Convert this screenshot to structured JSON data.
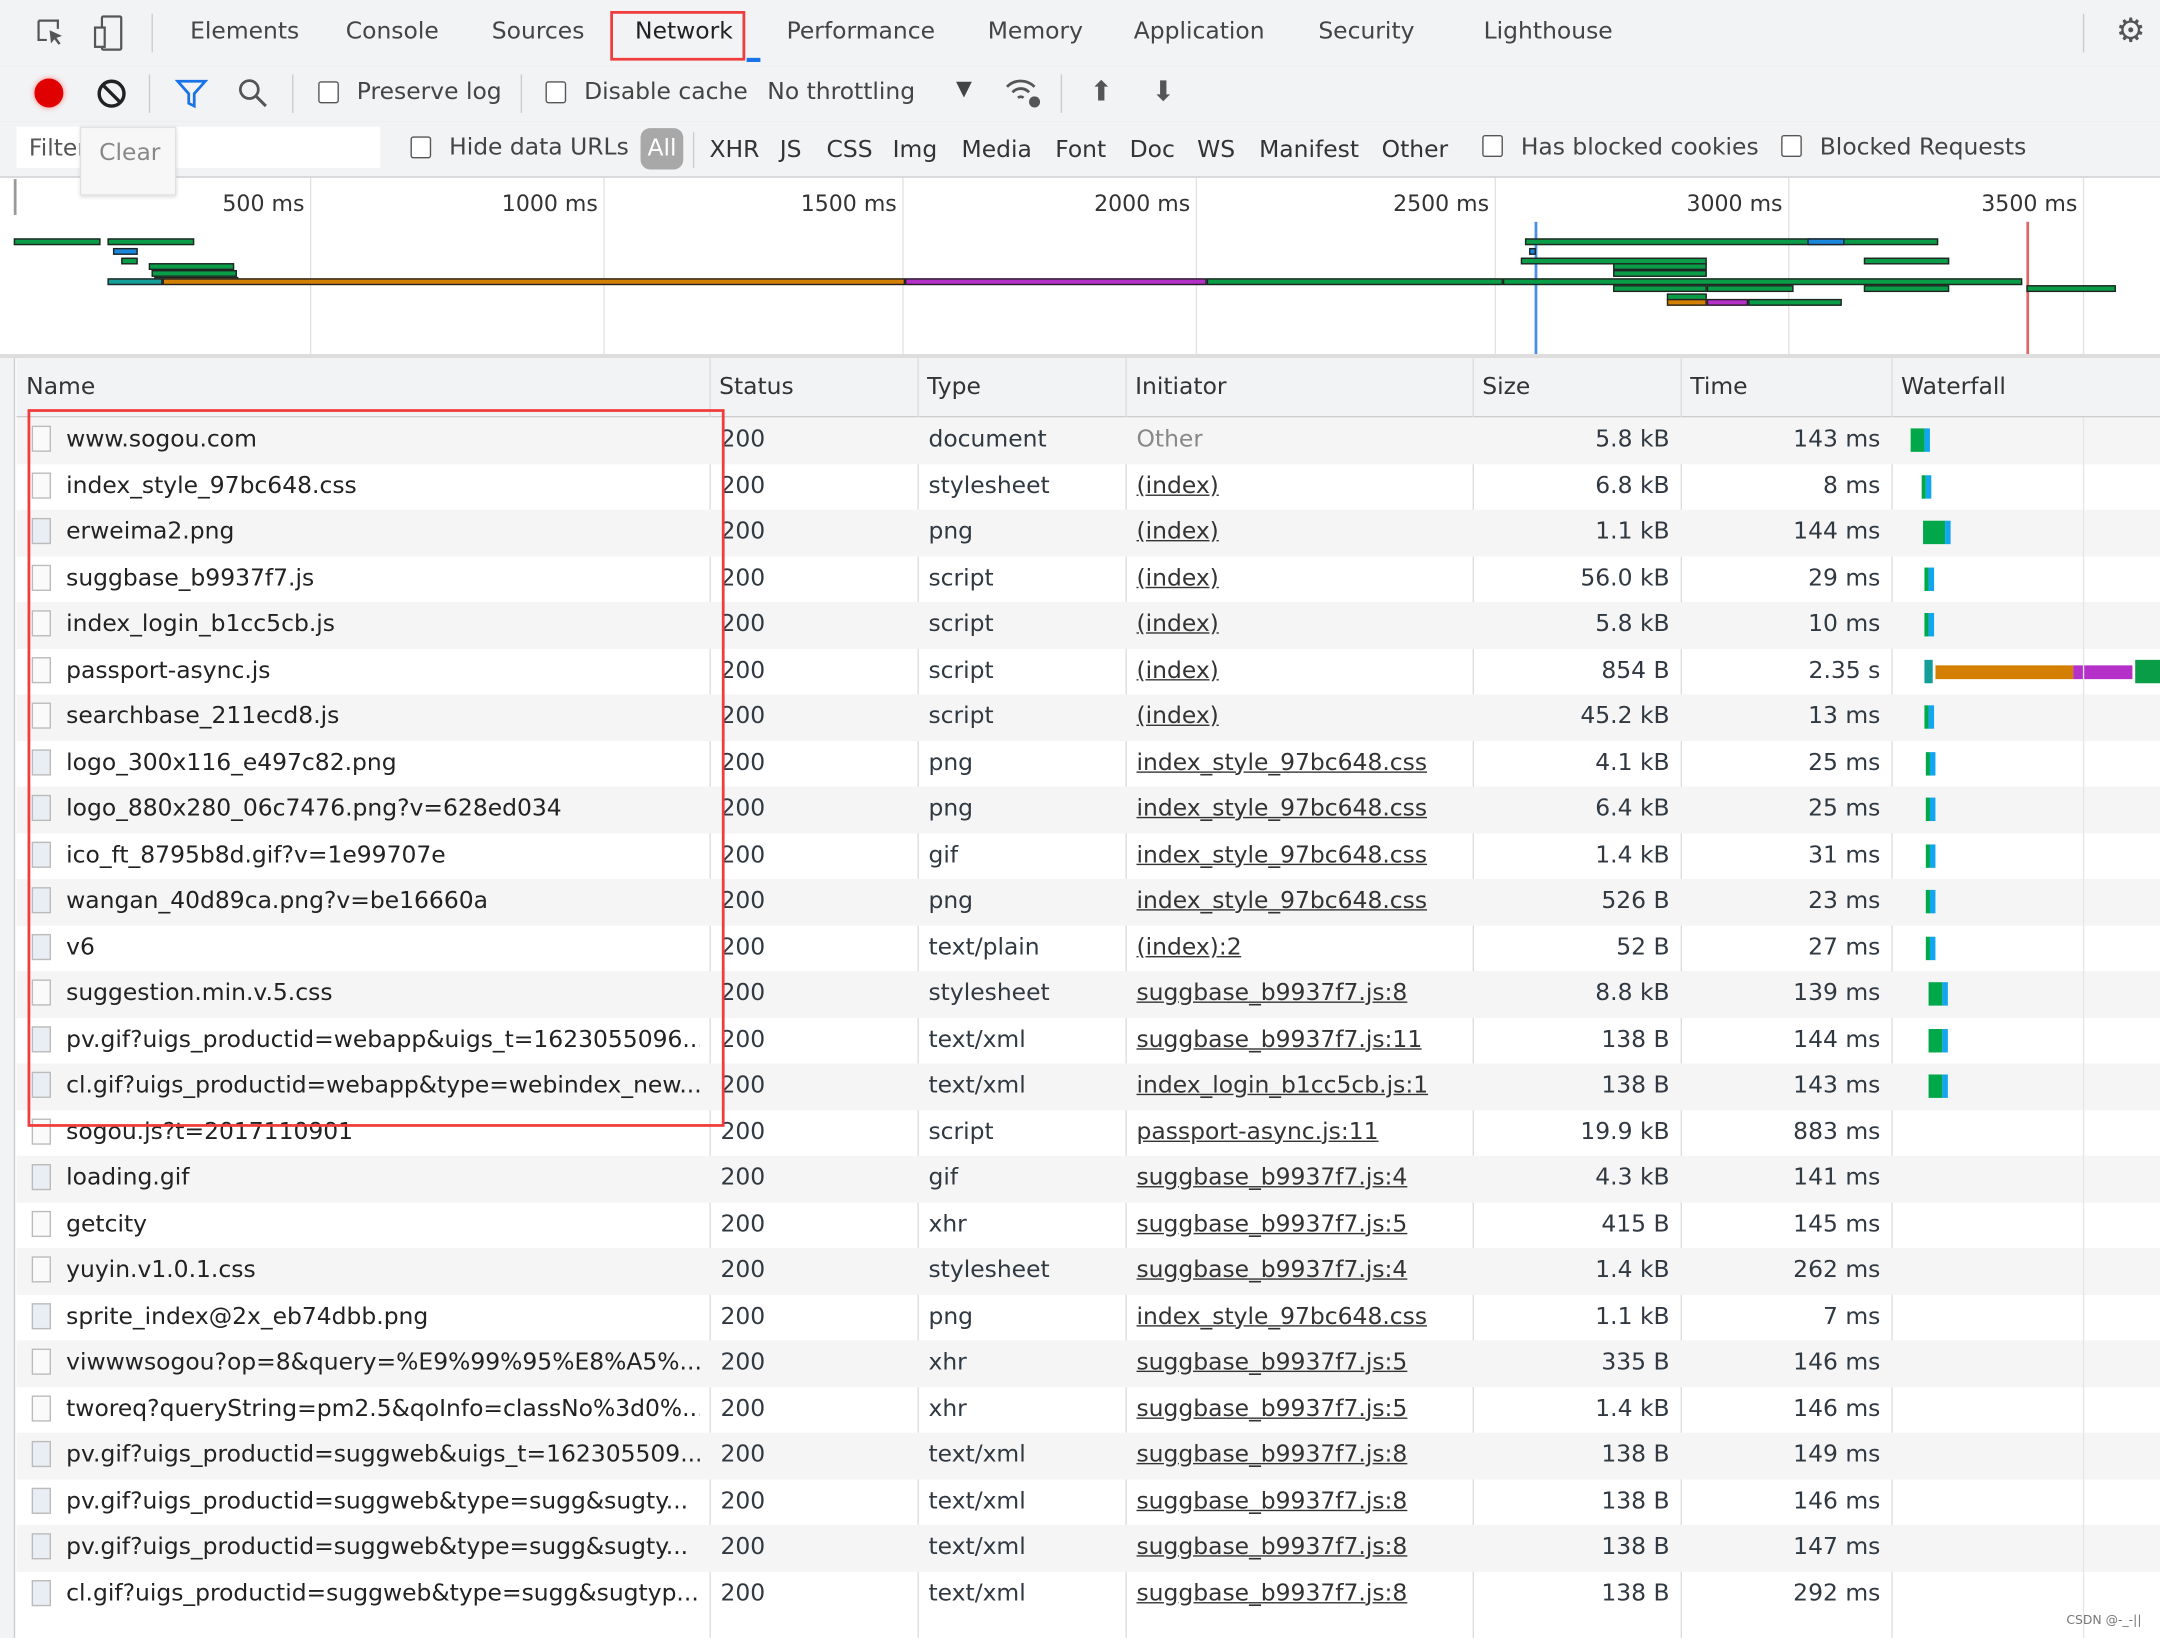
{
  "tabs": [
    "Elements",
    "Console",
    "Sources",
    "Network",
    "Performance",
    "Memory",
    "Application",
    "Security",
    "Lighthouse"
  ],
  "active_tab": "Network",
  "toolbar": {
    "preserve_log": "Preserve log",
    "disable_cache": "Disable cache",
    "throttling": "No throttling"
  },
  "filter": {
    "placeholder": "Filter",
    "clear_tooltip": "Clear",
    "hide_data_urls": "Hide data URLs",
    "types": [
      "All",
      "XHR",
      "JS",
      "CSS",
      "Img",
      "Media",
      "Font",
      "Doc",
      "WS",
      "Manifest",
      "Other"
    ],
    "has_blocked_cookies": "Has blocked cookies",
    "blocked_requests": "Blocked Requests"
  },
  "overview": {
    "ticks": [
      "500 ms",
      "1000 ms",
      "1500 ms",
      "2000 ms",
      "2500 ms",
      "3000 ms",
      "3500 ms"
    ],
    "dom_content_loaded_ms": 2570,
    "load_ms": 3400,
    "colors": {
      "green": "#0a9d48",
      "orange": "#d57f00",
      "purple": "#b52fc9",
      "teal": "#139e9a",
      "blue": "#1a87de"
    },
    "bars": [
      {
        "lane": 0,
        "s": 0,
        "e": 147,
        "c": "green"
      },
      {
        "lane": 0,
        "s": 158,
        "e": 305,
        "c": "green"
      },
      {
        "lane": 1,
        "s": 168,
        "e": 210,
        "c": "blue"
      },
      {
        "lane": 2,
        "s": 181,
        "e": 210,
        "c": "green"
      },
      {
        "lane": 3,
        "s": 228,
        "e": 372,
        "c": "green"
      },
      {
        "lane": 4,
        "s": 233,
        "e": 377,
        "c": "green"
      },
      {
        "lane": 5,
        "s": 237,
        "e": 379,
        "c": "green"
      },
      {
        "lane": 6,
        "s": 158,
        "e": 251,
        "c": "teal"
      },
      {
        "lane": 6,
        "s": 251,
        "e": 1505,
        "c": "orange"
      },
      {
        "lane": 6,
        "s": 1505,
        "e": 2016,
        "c": "purple"
      },
      {
        "lane": 6,
        "s": 2016,
        "e": 2516,
        "c": "green"
      },
      {
        "lane": 6,
        "s": 2516,
        "e": 3395,
        "c": "green"
      },
      {
        "lane": 0,
        "s": 2553,
        "e": 3253,
        "c": "green"
      },
      {
        "lane": 0,
        "s": 3030,
        "e": 3093,
        "c": "blue"
      },
      {
        "lane": 1,
        "s": 2560,
        "e": 2572,
        "c": "blue"
      },
      {
        "lane": 2,
        "s": 2547,
        "e": 2860,
        "c": "green"
      },
      {
        "lane": 2,
        "s": 3125,
        "e": 3270,
        "c": "green"
      },
      {
        "lane": 3,
        "s": 2702,
        "e": 2860,
        "c": "green"
      },
      {
        "lane": 4,
        "s": 2702,
        "e": 2860,
        "c": "green"
      },
      {
        "lane": 7,
        "s": 2702,
        "e": 2860,
        "c": "green"
      },
      {
        "lane": 7,
        "s": 2860,
        "e": 3007,
        "c": "green"
      },
      {
        "lane": 7,
        "s": 3125,
        "e": 3270,
        "c": "green"
      },
      {
        "lane": 7,
        "s": 3400,
        "e": 3553,
        "c": "green"
      },
      {
        "lane": 8,
        "s": 2793,
        "e": 2860,
        "c": "green"
      },
      {
        "lane": 9,
        "s": 2793,
        "e": 2860,
        "c": "orange"
      },
      {
        "lane": 9,
        "s": 2860,
        "e": 2930,
        "c": "purple"
      },
      {
        "lane": 9,
        "s": 2930,
        "e": 3088,
        "c": "green"
      }
    ]
  },
  "columns": [
    "Name",
    "Status",
    "Type",
    "Initiator",
    "Size",
    "Time",
    "Waterfall"
  ],
  "rows": [
    {
      "name": "www.sogou.com",
      "status": "200",
      "type": "document",
      "initiator": "Other",
      "size": "5.8 kB",
      "time": "143 ms",
      "wf": {
        "start": 0,
        "ms": 143
      }
    },
    {
      "name": "index_style_97bc648.css",
      "status": "200",
      "type": "stylesheet",
      "initiator": "(index)",
      "size": "6.8 kB",
      "time": "8 ms",
      "wf": {
        "start": 110,
        "ms": 20
      }
    },
    {
      "name": "erweima2.png",
      "status": "200",
      "type": "png",
      "initiator": "(index)",
      "size": "1.1 kB",
      "time": "144 ms",
      "wf": {
        "start": 130,
        "ms": 230
      }
    },
    {
      "name": "suggbase_b9937f7.js",
      "status": "200",
      "type": "script",
      "initiator": "(index)",
      "size": "56.0 kB",
      "time": "29 ms",
      "wf": {
        "start": 140,
        "ms": 30
      }
    },
    {
      "name": "index_login_b1cc5cb.js",
      "status": "200",
      "type": "script",
      "initiator": "(index)",
      "size": "5.8 kB",
      "time": "10 ms",
      "wf": {
        "start": 140,
        "ms": 20
      }
    },
    {
      "name": "passport-async.js",
      "status": "200",
      "type": "script",
      "initiator": "(index)",
      "size": "854 B",
      "time": "2.35 s",
      "wf": {
        "start": 140,
        "ms": 2350,
        "special": true
      }
    },
    {
      "name": "searchbase_211ecd8.js",
      "status": "200",
      "type": "script",
      "initiator": "(index)",
      "size": "45.2 kB",
      "time": "13 ms",
      "wf": {
        "start": 140,
        "ms": 20
      }
    },
    {
      "name": "logo_300x116_e497c82.png",
      "status": "200",
      "type": "png",
      "initiator": "index_style_97bc648.css",
      "size": "4.1 kB",
      "time": "25 ms",
      "wf": {
        "start": 150,
        "ms": 25
      }
    },
    {
      "name": "logo_880x280_06c7476.png?v=628ed034",
      "status": "200",
      "type": "png",
      "initiator": "index_style_97bc648.css",
      "size": "6.4 kB",
      "time": "25 ms",
      "wf": {
        "start": 150,
        "ms": 25
      }
    },
    {
      "name": "ico_ft_8795b8d.gif?v=1e99707e",
      "status": "200",
      "type": "gif",
      "initiator": "index_style_97bc648.css",
      "size": "1.4 kB",
      "time": "31 ms",
      "wf": {
        "start": 150,
        "ms": 35
      }
    },
    {
      "name": "wangan_40d89ca.png?v=be16660a",
      "status": "200",
      "type": "png",
      "initiator": "index_style_97bc648.css",
      "size": "526 B",
      "time": "23 ms",
      "wf": {
        "start": 150,
        "ms": 25
      }
    },
    {
      "name": "v6",
      "status": "200",
      "type": "text/plain",
      "initiator": "(index):2",
      "size": "52 B",
      "time": "27 ms",
      "wf": {
        "start": 150,
        "ms": 30
      }
    },
    {
      "name": "suggestion.min.v.5.css",
      "status": "200",
      "type": "stylesheet",
      "initiator": "suggbase_b9937f7.js:8",
      "size": "8.8 kB",
      "time": "139 ms",
      "wf": {
        "start": 185,
        "ms": 139
      }
    },
    {
      "name": "pv.gif?uigs_productid=webapp&uigs_t=1623055096...",
      "status": "200",
      "type": "text/xml",
      "initiator": "suggbase_b9937f7.js:11",
      "size": "138 B",
      "time": "144 ms",
      "wf": {
        "start": 185,
        "ms": 144
      }
    },
    {
      "name": "cl.gif?uigs_productid=webapp&type=webindex_new...",
      "status": "200",
      "type": "text/xml",
      "initiator": "index_login_b1cc5cb.js:1",
      "size": "138 B",
      "time": "143 ms",
      "wf": {
        "start": 185,
        "ms": 143
      }
    },
    {
      "name": "sogou.js?t=2017110901",
      "status": "200",
      "type": "script",
      "initiator": "passport-async.js:11",
      "size": "19.9 kB",
      "time": "883 ms"
    },
    {
      "name": "loading.gif",
      "status": "200",
      "type": "gif",
      "initiator": "suggbase_b9937f7.js:4",
      "size": "4.3 kB",
      "time": "141 ms"
    },
    {
      "name": "getcity",
      "status": "200",
      "type": "xhr",
      "initiator": "suggbase_b9937f7.js:5",
      "size": "415 B",
      "time": "145 ms"
    },
    {
      "name": "yuyin.v1.0.1.css",
      "status": "200",
      "type": "stylesheet",
      "initiator": "suggbase_b9937f7.js:4",
      "size": "1.4 kB",
      "time": "262 ms"
    },
    {
      "name": "sprite_index@2x_eb74dbb.png",
      "status": "200",
      "type": "png",
      "initiator": "index_style_97bc648.css",
      "size": "1.1 kB",
      "time": "7 ms"
    },
    {
      "name": "viwwwsogou?op=8&query=%E9%99%95%E8%A5%...",
      "status": "200",
      "type": "xhr",
      "initiator": "suggbase_b9937f7.js:5",
      "size": "335 B",
      "time": "146 ms"
    },
    {
      "name": "tworeq?queryString=pm2.5&qoInfo=classNo%3d0%...",
      "status": "200",
      "type": "xhr",
      "initiator": "suggbase_b9937f7.js:5",
      "size": "1.4 kB",
      "time": "146 ms"
    },
    {
      "name": "pv.gif?uigs_productid=suggweb&uigs_t=162305509...",
      "status": "200",
      "type": "text/xml",
      "initiator": "suggbase_b9937f7.js:8",
      "size": "138 B",
      "time": "149 ms"
    },
    {
      "name": "pv.gif?uigs_productid=suggweb&type=sugg&sugty...",
      "status": "200",
      "type": "text/xml",
      "initiator": "suggbase_b9937f7.js:8",
      "size": "138 B",
      "time": "146 ms"
    },
    {
      "name": "pv.gif?uigs_productid=suggweb&type=sugg&sugty...",
      "status": "200",
      "type": "text/xml",
      "initiator": "suggbase_b9937f7.js:8",
      "size": "138 B",
      "time": "147 ms"
    },
    {
      "name": "cl.gif?uigs_productid=suggweb&type=sugg&sugtyp...",
      "status": "200",
      "type": "text/xml",
      "initiator": "suggbase_b9937f7.js:8",
      "size": "138 B",
      "time": "292 ms"
    }
  ],
  "highlight_color": "#f03c3c",
  "watermark": "CSDN @-_-||"
}
